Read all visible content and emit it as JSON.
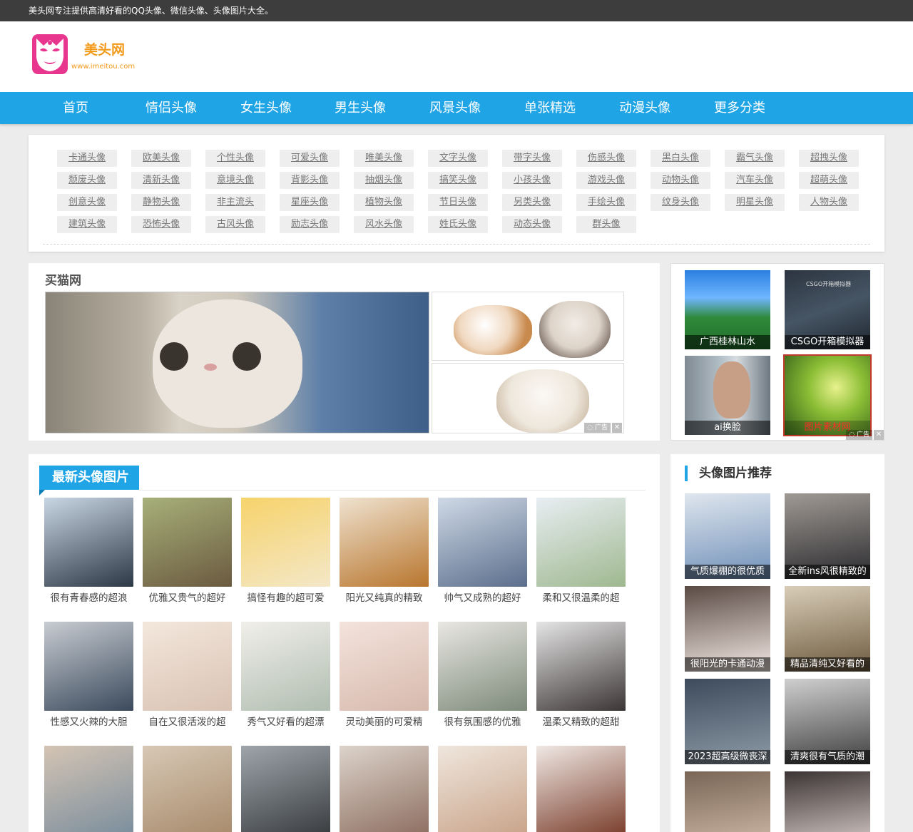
{
  "topbar": {
    "text": "美头网专注提供高清好看的QQ头像、微信头像、头像图片大全。"
  },
  "logo": {
    "name": "美头网",
    "url_text": "www.imeitou.com"
  },
  "nav": [
    "首页",
    "情侣头像",
    "女生头像",
    "男生头像",
    "风景头像",
    "单张精选",
    "动漫头像",
    "更多分类"
  ],
  "tags": [
    "卡通头像",
    "欧美头像",
    "个性头像",
    "可爱头像",
    "唯美头像",
    "文字头像",
    "带字头像",
    "伤感头像",
    "黑白头像",
    "霸气头像",
    "超拽头像",
    "颓废头像",
    "清新头像",
    "意境头像",
    "背影头像",
    "抽烟头像",
    "搞笑头像",
    "小孩头像",
    "游戏头像",
    "动物头像",
    "汽车头像",
    "超萌头像",
    "创意头像",
    "静物头像",
    "非主流头",
    "星座头像",
    "植物头像",
    "节日头像",
    "另类头像",
    "手绘头像",
    "纹身头像",
    "明星头像",
    "人物头像",
    "建筑头像",
    "恐怖头像",
    "古风头像",
    "励志头像",
    "风水头像",
    "姓氏头像",
    "动态头像",
    "群头像"
  ],
  "ad_left": {
    "title": "买猫网",
    "ad_label": "广告",
    "close": "✕"
  },
  "ad_right": {
    "items": [
      {
        "caption": "广西桂林山水",
        "highlight": false
      },
      {
        "caption": "CSGO开箱模拟器",
        "highlight": false
      },
      {
        "caption": "ai换脸",
        "highlight": false
      },
      {
        "caption": "图片素材网",
        "highlight": true
      }
    ],
    "inner_text": "CSGO开箱模拟器",
    "ad_label": "广告",
    "close": "✕"
  },
  "latest": {
    "title": "最新头像图片",
    "items": [
      "很有青春感的超浪",
      "优雅又贵气的超好",
      "搞怪有趣的超可爱",
      "阳光又纯真的精致",
      "帅气又成熟的超好",
      "柔和又很温柔的超",
      "性感又火辣的大胆",
      "自在又很活泼的超",
      "秀气又好看的超漂",
      "灵动美丽的可爱精",
      "很有氛围感的优雅",
      "温柔又精致的超甜",
      "",
      "",
      "",
      "",
      "",
      ""
    ]
  },
  "reco": {
    "title": "头像图片推荐",
    "items": [
      "气质爆棚的很优质",
      "全新ins风很精致的",
      "很阳光的卡通动漫",
      "精品清纯又好看的",
      "2023超高级微丧深",
      "清爽很有气质的潮",
      "",
      ""
    ]
  },
  "colors": {
    "brand_blue": "#1fa4e5",
    "topbar": "#3d3d3d",
    "ad_red": "#ff2a2a"
  }
}
